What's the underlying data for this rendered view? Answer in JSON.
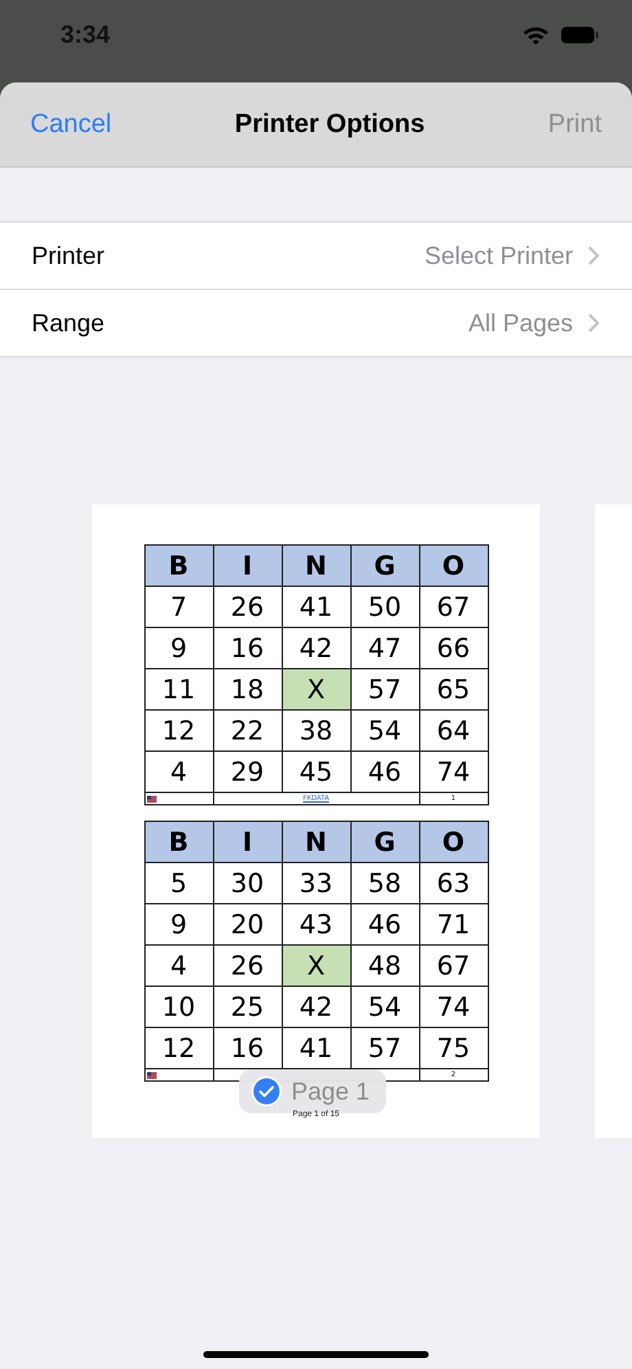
{
  "status_bar": {
    "time": "3:34"
  },
  "nav": {
    "cancel": "Cancel",
    "title": "Printer Options",
    "print": {
      "label": "Print",
      "disabled": true
    }
  },
  "options": [
    {
      "label": "Printer",
      "value": "Select Printer"
    },
    {
      "label": "Range",
      "value": "All Pages"
    }
  ],
  "preview": {
    "cards": [
      {
        "header": [
          "B",
          "I",
          "N",
          "G",
          "O"
        ],
        "rows": [
          [
            "7",
            "26",
            "41",
            "50",
            "67"
          ],
          [
            "9",
            "16",
            "42",
            "47",
            "66"
          ],
          [
            "11",
            "18",
            {
              "text": "X",
              "free": true
            },
            "57",
            "65"
          ],
          [
            "12",
            "22",
            "38",
            "54",
            "64"
          ],
          [
            "4",
            "29",
            "45",
            "46",
            "74"
          ]
        ],
        "footer": {
          "link": "FKDATA",
          "number": "1"
        }
      },
      {
        "header": [
          "B",
          "I",
          "N",
          "G",
          "O"
        ],
        "rows": [
          [
            "5",
            "30",
            "33",
            "58",
            "63"
          ],
          [
            "9",
            "20",
            "43",
            "46",
            "71"
          ],
          [
            "4",
            "26",
            {
              "text": "X",
              "free": true
            },
            "48",
            "67"
          ],
          [
            "10",
            "25",
            "42",
            "54",
            "74"
          ],
          [
            "12",
            "16",
            "41",
            "57",
            "75"
          ]
        ],
        "footer": {
          "number": "2"
        }
      }
    ],
    "page_badge": {
      "label": "Page 1",
      "selected": true
    },
    "page_footer": "Page 1 of 15"
  }
}
